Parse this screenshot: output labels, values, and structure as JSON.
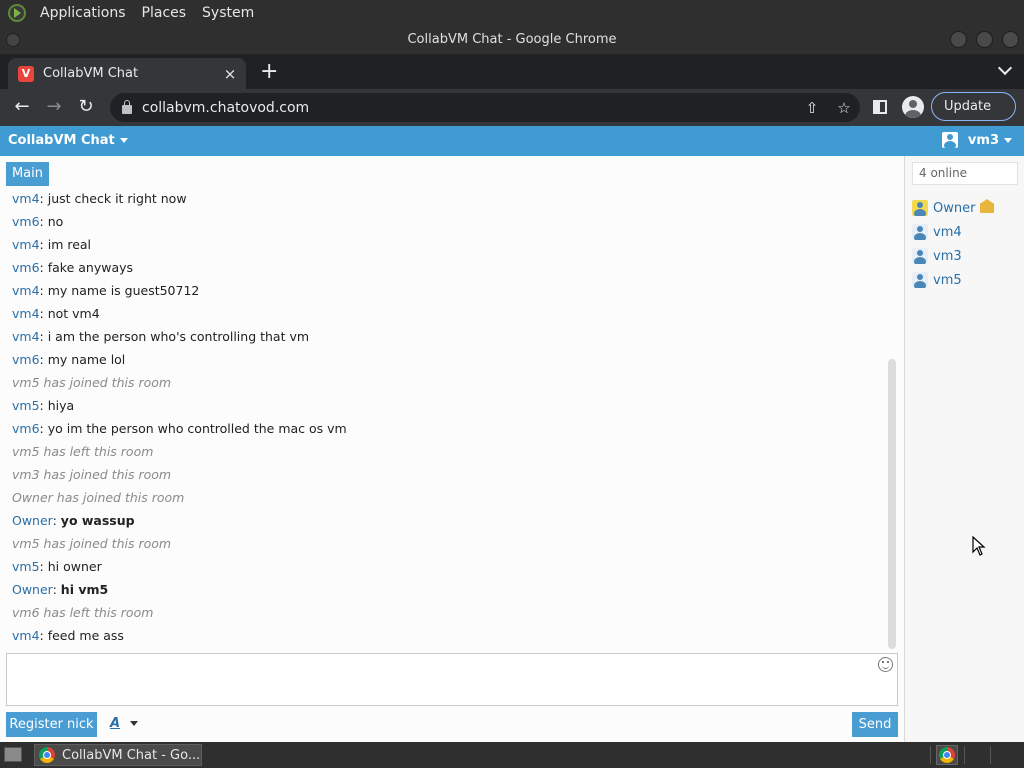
{
  "desktop": {
    "menus": [
      "Applications",
      "Places",
      "System"
    ]
  },
  "window": {
    "title": "CollabVM Chat - Google Chrome"
  },
  "browser": {
    "tab_title": "CollabVM Chat",
    "tab_close": "×",
    "new_tab": "+",
    "url": "collabvm.chatovod.com",
    "update_label": "Update",
    "update_menu": "⋮",
    "back": "←",
    "forward": "→",
    "reload": "↻",
    "share": "⇧",
    "bookmark": "☆"
  },
  "app": {
    "menu_label": "CollabVM Chat",
    "current_user": "vm3",
    "room_tab": "Main",
    "messages": [
      {
        "nick": "vm4",
        "text": "just check it right now"
      },
      {
        "nick": "vm6",
        "text": "no"
      },
      {
        "nick": "vm4",
        "text": "im real"
      },
      {
        "nick": "vm6",
        "text": "fake anyways"
      },
      {
        "nick": "vm4",
        "text": "my name is guest50712"
      },
      {
        "nick": "vm4",
        "text": "not vm4"
      },
      {
        "nick": "vm4",
        "text": "i am the person who's controlling that vm"
      },
      {
        "nick": "vm6",
        "text": "my name lol"
      },
      {
        "system": "vm5 has joined this room"
      },
      {
        "nick": "vm5",
        "text": "hiya"
      },
      {
        "nick": "vm6",
        "text": "yo im the person who controlled the mac os vm"
      },
      {
        "system": "vm5 has left this room"
      },
      {
        "system": "vm3 has joined this room"
      },
      {
        "system": "Owner has joined this room"
      },
      {
        "nick": "Owner",
        "text": "yo wassup",
        "bold": true
      },
      {
        "system": "vm5 has joined this room"
      },
      {
        "nick": "vm5",
        "text": "hi owner"
      },
      {
        "nick": "Owner",
        "text": "hi vm5",
        "bold": true
      },
      {
        "system": "vm6 has left this room"
      },
      {
        "nick": "vm4",
        "text": "feed me ass"
      }
    ],
    "register_label": "Register nick",
    "font_label": "A",
    "send_label": "Send",
    "online_label": "4 online",
    "users": [
      {
        "name": "Owner",
        "owner": true
      },
      {
        "name": "vm4",
        "owner": false
      },
      {
        "name": "vm3",
        "owner": false
      },
      {
        "name": "vm5",
        "owner": false
      }
    ]
  },
  "taskbar": {
    "task_label": "CollabVM Chat - Go..."
  },
  "colors": {
    "accent": "#3f9bd1",
    "nick": "#2a6fa8",
    "system_text": "#8a8a8a"
  }
}
